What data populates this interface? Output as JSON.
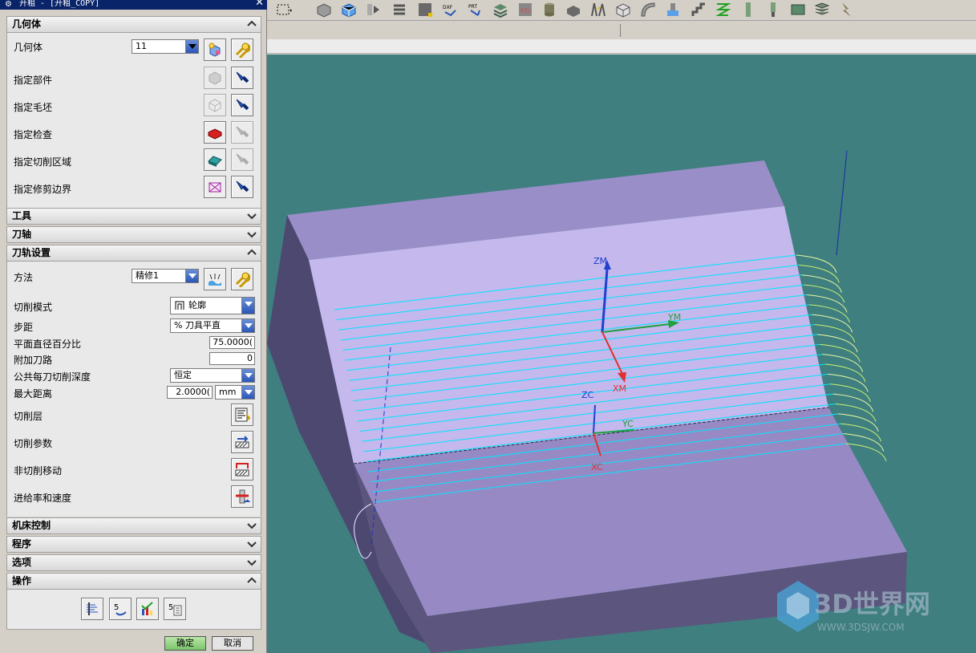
{
  "window": {
    "title": "开粗 - [开粗_COPY]"
  },
  "sections": {
    "geometry": {
      "header": "几何体",
      "geometry_label": "几何体",
      "geometry_value": "11",
      "specify_part": "指定部件",
      "specify_blank": "指定毛坯",
      "specify_check": "指定检查",
      "specify_cut_area": "指定切削区域",
      "specify_trim_boundary": "指定修剪边界"
    },
    "tool": {
      "header": "工具"
    },
    "tool_axis": {
      "header": "刀轴"
    },
    "path_settings": {
      "header": "刀轨设置",
      "method_label": "方法",
      "method_value": "精修1",
      "cut_pattern_label": "切削模式",
      "cut_pattern_value": "轮廓",
      "stepover_label": "步距",
      "stepover_value": "% 刀具平直",
      "flat_diameter_pct_label": "平面直径百分比",
      "flat_diameter_pct_value": "75.0000(",
      "additional_passes_label": "附加刀路",
      "additional_passes_value": "0",
      "depth_per_cut_label": "公共每刀切削深度",
      "depth_per_cut_value": "恒定",
      "max_distance_label": "最大距离",
      "max_distance_value": "2.0000(",
      "max_distance_unit": "mm",
      "cut_levels": "切削层",
      "cut_parameters": "切削参数",
      "non_cutting_moves": "非切削移动",
      "feeds_speeds": "进给率和速度"
    },
    "machine_control": {
      "header": "机床控制"
    },
    "program": {
      "header": "程序"
    },
    "options": {
      "header": "选项"
    },
    "actions": {
      "header": "操作"
    }
  },
  "buttons": {
    "ok": "确定",
    "cancel": "取消"
  },
  "viewport": {
    "axes": {
      "zm": "ZM",
      "ym": "YM",
      "xm": "XM",
      "zc": "ZC",
      "yc": "YC",
      "xc": "XC"
    },
    "watermark": {
      "brand": "3D世界网",
      "url": "WWW.3DSJW.COM"
    }
  },
  "colors": {
    "viewport_bg": "#3f7f80",
    "title_bar": "#0a246a",
    "toolpath": "#00e5ff",
    "engage": "#c8f070"
  }
}
